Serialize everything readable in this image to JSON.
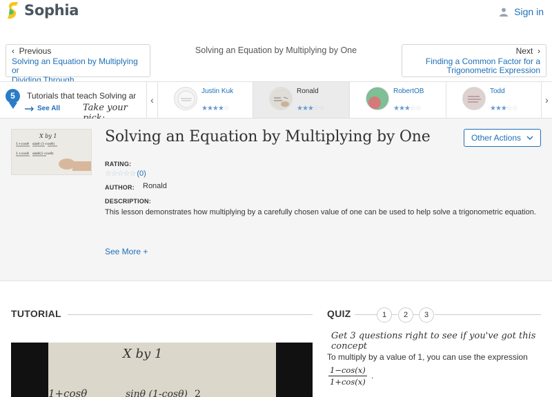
{
  "header": {
    "logo_text": "Sophia",
    "signin_label": "Sign in",
    "colors": {
      "brand_green": "#f7c51e",
      "link": "#1d6fb8"
    }
  },
  "nav": {
    "previous_label": "Previous",
    "previous_link": [
      "Solving an Equation by Multiplying or",
      "Dividing Through"
    ],
    "center_title": "Solving an Equation by Multiplying by One",
    "next_label": "Next",
    "next_link": [
      "Finding a Common Factor for a",
      "Trigonometric Expression"
    ]
  },
  "strip": {
    "badge": "5",
    "text": "Tutorials that teach Solving an E",
    "see_all": "See All",
    "pick": "Take your pick:",
    "cards": [
      {
        "name": "Justin Kuk",
        "stars": 4,
        "active": false
      },
      {
        "name": "Ronald",
        "stars": 3,
        "active": true
      },
      {
        "name": "RobertOB",
        "stars": 3,
        "active": false
      },
      {
        "name": "Todd",
        "stars": 3,
        "active": false
      }
    ]
  },
  "detail": {
    "title": "Solving an Equation by Multiplying by One",
    "other_actions": "Other Actions",
    "rating_label": "RATING:",
    "rating_count": "(0)",
    "author_label": "AUTHOR:",
    "author": "Ronald",
    "description_label": "DESCRIPTION:",
    "description": "This lesson demonstrates how multiplying by a carefully chosen value of one can be used to help solve a trigonometric equation.",
    "see_more": "See More +"
  },
  "tutorial": {
    "heading": "TUTORIAL"
  },
  "quiz": {
    "heading": "QUIZ",
    "numbers": [
      "1",
      "2",
      "3"
    ],
    "prompt": "Get 3 questions right to see if you've got this concept",
    "question": "To multiply by a value of 1, you can use the expression",
    "frac_num": "1−cos(x)",
    "frac_den": "1+cos(x)",
    "frac_end": "."
  }
}
